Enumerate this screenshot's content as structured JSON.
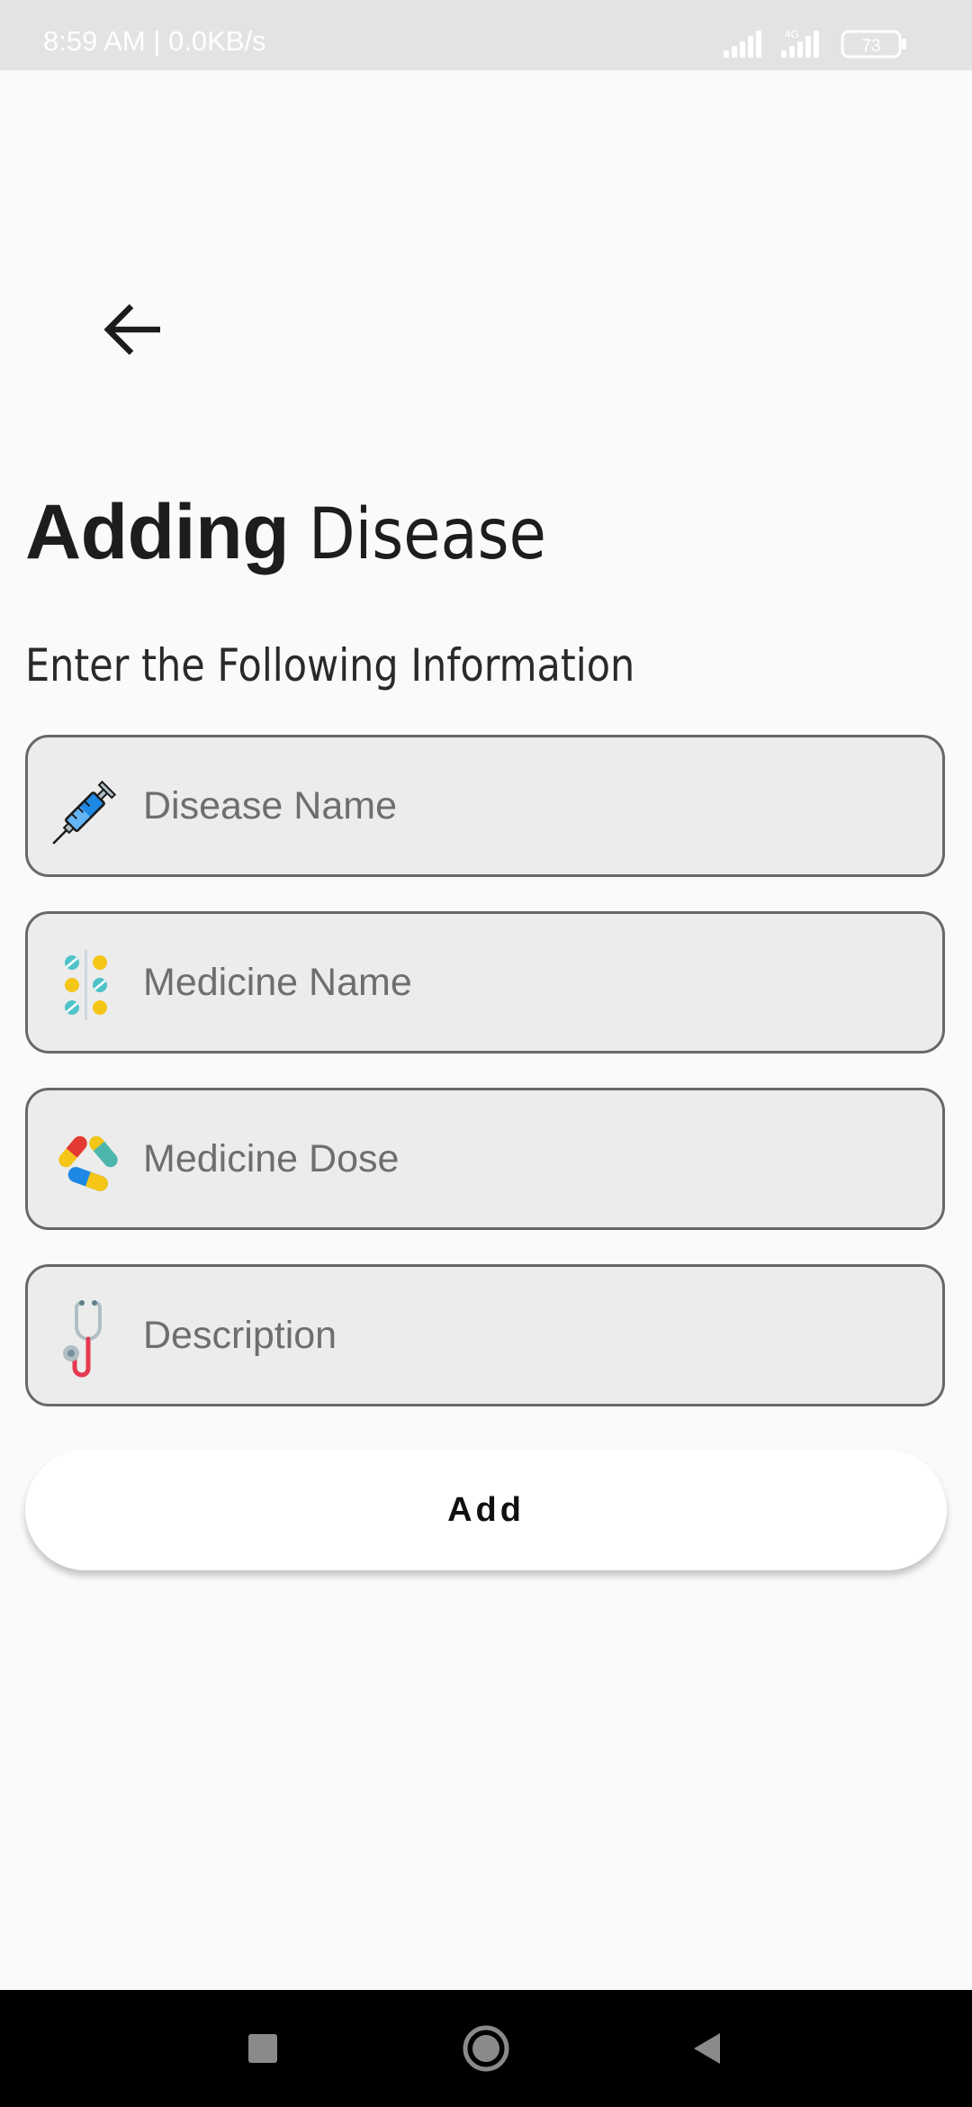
{
  "status_bar": {
    "time_speed": "8:59 AM | 0.0KB/s",
    "network": "4G",
    "battery": "73"
  },
  "header": {
    "back_icon": "arrow-left-icon",
    "title_bold": "Adding",
    "title_light": "Disease",
    "subtitle": "Enter the Following Information"
  },
  "form": {
    "fields": [
      {
        "icon": "syringe-icon",
        "placeholder": "Disease Name",
        "value": ""
      },
      {
        "icon": "pills-icon",
        "placeholder": "Medicine Name",
        "value": ""
      },
      {
        "icon": "capsules-icon",
        "placeholder": "Medicine Dose",
        "value": ""
      },
      {
        "icon": "stethoscope-icon",
        "placeholder": "Description",
        "value": ""
      }
    ],
    "submit_label": "Add"
  },
  "nav_bar": {
    "items": [
      "recents-square-icon",
      "home-circle-icon",
      "back-triangle-icon"
    ]
  },
  "colors": {
    "background": "#fafafa",
    "field_background": "#ececec",
    "field_border": "#686868",
    "button_background": "#ffffff",
    "nav_bar": "#000000"
  }
}
